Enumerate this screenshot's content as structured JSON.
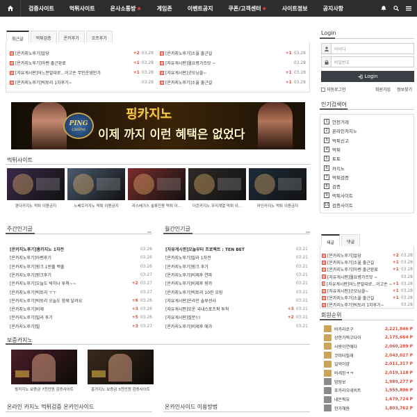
{
  "nav": {
    "items": [
      {
        "label": "검증사이트",
        "fire": false
      },
      {
        "label": "먹튀사이트",
        "fire": false
      },
      {
        "label": "온사소통방",
        "fire": true
      },
      {
        "label": "게임존",
        "fire": false
      },
      {
        "label": "이벤트공지",
        "fire": false
      },
      {
        "label": "쿠폰/고객센터",
        "fire": true
      },
      {
        "label": "사이트정보",
        "fire": false
      },
      {
        "label": "공지사항",
        "fire": false
      }
    ]
  },
  "recent": {
    "tabs": [
      "최근글",
      "먹튀검증",
      "온카후기",
      "오프후기"
    ],
    "left": [
      {
        "title": "[온카지노후기]알당",
        "plus": "+2",
        "date": "03.28"
      },
      {
        "title": "[온카지노후기]아벤 출근완료",
        "plus": "+1",
        "date": "03.28"
      },
      {
        "title": "[자유게시판]어느분말대로...이고손 무인운영인가",
        "plus": "+1",
        "date": "03.28"
      },
      {
        "title": "[온카지노후기]빅토리 1차후기~",
        "plus": "",
        "date": "03.28"
      }
    ],
    "right": [
      {
        "title": "[온카지노후기]소울 출근길",
        "plus": "+1",
        "date": "03.28"
      },
      {
        "title": "[자유게시판]월요병가즈앗 ~",
        "plus": "",
        "date": "03.28"
      },
      {
        "title": "[자유게시판]굿모닝쓸~",
        "plus": "+1",
        "date": "03.28"
      },
      {
        "title": "[온카지노후기]소울 출근길",
        "plus": "+1",
        "date": "03.28"
      }
    ]
  },
  "banner": {
    "logo_top": "PING",
    "logo_bottom": "casino",
    "brand": "핑카지노",
    "slogan": "이제 까지 이런 혜택은 없었다"
  },
  "scam": {
    "title": "먹튀사이트",
    "items": [
      {
        "caption": "판다카지노 먹튀 이용금지",
        "color": "#3a2a4a"
      },
      {
        "caption": "노베르카지노 먹튀 이용금지",
        "color": "#4a5a6e"
      },
      {
        "caption": "라스베가스 슬롯전용 먹튀 이...",
        "color": "#7b2c2c"
      },
      {
        "caption": "더콘카지노 우리계열 먹튀 이...",
        "color": "#2e2a28"
      },
      {
        "caption": "라인카지노 먹튀 이용금지",
        "color": "#1e2c3a"
      }
    ]
  },
  "weekly": {
    "title": "주간인기글",
    "items": [
      {
        "title": "[온카지노후기]홍카지노 1차전",
        "plus": "",
        "date": "03.26",
        "bold": true
      },
      {
        "title": "[온카지노후기]아벤후기",
        "plus": "",
        "date": "03.26",
        "bold": false
      },
      {
        "title": "[온카지노후기]핑크 1번출 백출",
        "plus": "",
        "date": "03.26",
        "bold": false
      },
      {
        "title": "[온카지노후기]핑크후기",
        "plus": "",
        "date": "03.27",
        "bold": false
      },
      {
        "title": "[온카지노후기]오늘도 빅히나 투척~~",
        "plus": "+2",
        "date": "03.27",
        "bold": false
      },
      {
        "title": "[온카지노후기]빅토리 ㅜㅜ",
        "plus": "",
        "date": "03.27",
        "bold": false
      },
      {
        "title": "[온카지노후기]빅토리 오늘도 함께 달려요",
        "plus": "+6",
        "date": "03.26",
        "bold": false
      },
      {
        "title": "[온카지노후기]비제",
        "plus": "+3",
        "date": "03.26",
        "bold": false
      },
      {
        "title": "[온카지노후기]빌라 후기",
        "plus": "+5",
        "date": "03.26",
        "bold": false
      },
      {
        "title": "[온카지노후기]빌",
        "plus": "+3",
        "date": "03.27",
        "bold": false
      }
    ]
  },
  "monthly": {
    "title": "월간인기글",
    "items": [
      {
        "title": "[자유게시판]오늘부터 프로젝트 : TEN BET",
        "plus": "",
        "date": "03.21",
        "bold": true
      },
      {
        "title": "[온카지노후기]빌라 1차전",
        "plus": "",
        "date": "03.21",
        "bold": false
      },
      {
        "title": "[온카지노후기]핑크 후기",
        "plus": "",
        "date": "03.21",
        "bold": false
      },
      {
        "title": "[온카지노후기]비제후 연파",
        "plus": "",
        "date": "03.21",
        "bold": false
      },
      {
        "title": "[온카지노후기]비제후 핑카",
        "plus": "",
        "date": "03.21",
        "bold": false
      },
      {
        "title": "[온카지노후기]빅토리 10만 오링",
        "plus": "",
        "date": "03.21",
        "bold": false
      },
      {
        "title": "[자유게시판]온라인 솔루션사",
        "plus": "",
        "date": "03.21",
        "bold": false
      },
      {
        "title": "[자유게시판]오운 국내스포츠픽 투척",
        "plus": "+3",
        "date": "03.21",
        "bold": false
      },
      {
        "title": "[자유게시판]질문!!!",
        "plus": "+2",
        "date": "03.21",
        "bold": false
      },
      {
        "title": "[온카지노후기]비제후 애가",
        "plus": "",
        "date": "03.21",
        "bold": false
      }
    ]
  },
  "guarantee": {
    "title": "보증카지노",
    "items": [
      {
        "caption": "핑카지노 보증금 7천만원 검증사이트",
        "color": "#4a1e2a"
      },
      {
        "caption": "홍카지노 보증금 3천만원 검증사이트",
        "color": "#3a2a1c"
      }
    ]
  },
  "bottom": {
    "left_title": "온라인 카지노 먹튀검증 온카인사이드",
    "right_title": "온카인사이드 이용방법"
  },
  "login": {
    "title": "Login",
    "id_placeholder": "아이디",
    "pw_placeholder": "비밀번호",
    "button": "Login",
    "auto": "자동로그인",
    "join": "회원가입",
    "find": "정보찾기"
  },
  "keywords": {
    "title": "인기검색어",
    "items": [
      "안전거래",
      "온라인카지노",
      "먹튀신고",
      "먹튀",
      "토토",
      "카지노",
      "먹튀검증",
      "검증",
      "먹튀사이트",
      "검증사이트"
    ]
  },
  "side_posts": {
    "tabs": [
      "새글",
      "댓글"
    ],
    "items": [
      {
        "title": "[온카지노후기]알당",
        "plus": "+2",
        "date": "03.28"
      },
      {
        "title": "[온카지노후기]소울 출근길",
        "plus": "+1",
        "date": "03.28"
      },
      {
        "title": "[온카지노후기]아벤 출근완료",
        "plus": "+1",
        "date": "03.28"
      },
      {
        "title": "[자유게시판]월요병가즈앗 ~",
        "plus": "",
        "date": "03.28"
      },
      {
        "title": "[자유게시판]어느분말대로...이고손 ~",
        "plus": "+1",
        "date": "03.28"
      },
      {
        "title": "[자유게시판]굿모닝쓸~",
        "plus": "+1",
        "date": "03.28"
      },
      {
        "title": "[온카지노후기]소울 출근길",
        "plus": "+1",
        "date": "03.28"
      },
      {
        "title": "[온카지노후기]빅토리 1차후기~",
        "plus": "",
        "date": "03.28"
      }
    ]
  },
  "ranking": {
    "title": "회원순위",
    "items": [
      {
        "name": "바카라로구",
        "points": "2,221,846 P"
      },
      {
        "name": "상한가찍고다이",
        "points": "2,175,664 P"
      },
      {
        "name": "사랑이연애다",
        "points": "2,060,289 P"
      },
      {
        "name": "코피터질래",
        "points": "2,043,027 P"
      },
      {
        "name": "일억이얌",
        "points": "2,011,317 P"
      },
      {
        "name": "비세된ㅋㅋ",
        "points": "2,019,118 P"
      },
      {
        "name": "땀땀보",
        "points": "1,989,277 P"
      },
      {
        "name": "포카라오네비트",
        "points": "1,955,806 P"
      },
      {
        "name": "내돈줘요",
        "points": "1,679,724 P"
      },
      {
        "name": "한가해용",
        "points": "1,803,762 P"
      }
    ]
  },
  "colors": {
    "accent": "#e14b38",
    "nav": "#2d2d2d"
  }
}
